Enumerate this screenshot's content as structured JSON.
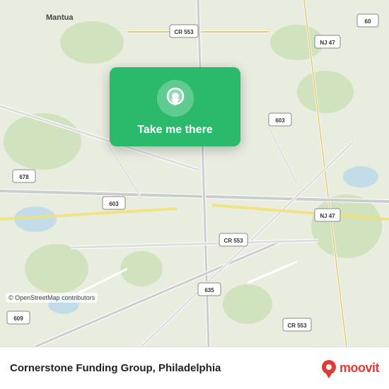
{
  "map": {
    "background_color": "#e8f0e0",
    "attribution": "© OpenStreetMap contributors"
  },
  "popup": {
    "label": "Take me there",
    "background_color": "#2bba6b",
    "icon": "location-pin-icon"
  },
  "bottom_bar": {
    "company_name": "Cornerstone Funding Group, Philadelphia",
    "moovit_text": "moovit",
    "logo_icon": "moovit-pin-icon"
  }
}
